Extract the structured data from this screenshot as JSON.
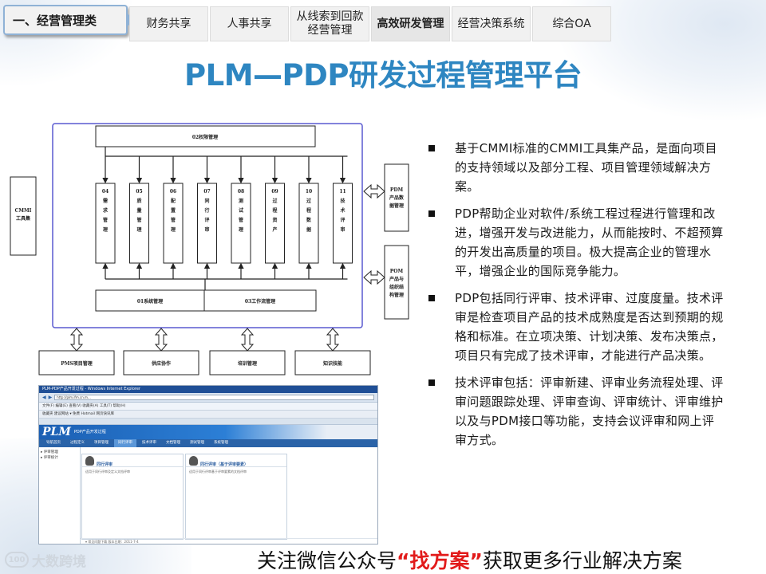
{
  "nav": {
    "category": "一、经营管理类",
    "tabs": [
      {
        "label": "财务共享",
        "active": false
      },
      {
        "label": "人事共享",
        "active": false
      },
      {
        "label": "从线索到回款\n经营管理",
        "active": false
      },
      {
        "label": "高效研发管理",
        "active": true
      },
      {
        "label": "经营决策系统",
        "active": false
      },
      {
        "label": "综合OA",
        "active": false
      }
    ]
  },
  "title": "PLM—PDP研发过程管理平台",
  "diagram": {
    "top_box": "02权限管理",
    "modules": [
      [
        "04",
        "需",
        "求",
        "管",
        "理"
      ],
      [
        "05",
        "质",
        "量",
        "管",
        "理"
      ],
      [
        "06",
        "配",
        "置",
        "管",
        "理"
      ],
      [
        "07",
        "同",
        "行",
        "评",
        "审"
      ],
      [
        "08",
        "测",
        "试",
        "管",
        "理"
      ],
      [
        "09",
        "过",
        "程",
        "资",
        "产"
      ],
      [
        "10",
        "过",
        "程",
        "数",
        "据"
      ],
      [
        "11",
        "技",
        "术",
        "评",
        "审"
      ]
    ],
    "bottom_left": "01系统管理",
    "bottom_right": "03工作流管理",
    "cmmi_box": [
      "CMMI",
      "工具集"
    ],
    "pdm_box": [
      "PDM",
      "产品数",
      "据管理"
    ],
    "pom_box": [
      "POM",
      "产品与",
      "组织结",
      "构管理"
    ],
    "bottom_boxes": [
      "PMS项目管理",
      "供应协作",
      "培训管理",
      "知识技能"
    ]
  },
  "screenshot": {
    "window_title": "PLM-PDP产品开发过程 - Windows Internet Explorer",
    "url": "http://plm.ifm.cn.m...",
    "menu": "文件(F)  编辑(E)  查看(V)  收藏夹(A)  工具(T)  帮助(H)",
    "favorites": "收藏夹   建议网站 ▾   免费 Hotmail   网页快讯库",
    "logo": "PLM",
    "logo_sub": "PDP产品开发过程",
    "nav_items": [
      {
        "label": "导航首页",
        "active": false
      },
      {
        "label": "过程定义",
        "active": false
      },
      {
        "label": "项目管理",
        "active": false
      },
      {
        "label": "同行评审",
        "active": true
      },
      {
        "label": "技术评审",
        "active": false
      },
      {
        "label": "文档管理",
        "active": false
      },
      {
        "label": "测试管理",
        "active": false
      },
      {
        "label": "系统管理",
        "active": false
      }
    ],
    "side_items": [
      "▸ 评审管理",
      "▸ 评审统计"
    ],
    "panel_left_title": "同行评审",
    "panel_left_body": "适用于同行评审及定义文档评审",
    "panel_right_title": "同行评审（基于评审要素）",
    "panel_right_body": "适用于同行评审基于评审要素的文档评审",
    "footer": "▾ 常见问题下载    版本日期：2011-7-4"
  },
  "bullets": [
    "基于CMMI标准的CMMI工具集产品，是面向项目的支持领域以及部分工程、项目管理领域解决方案。",
    "PDP帮助企业对软件/系统工程过程进行管理和改进，增强开发与改进能力，从而能按时、不超预算的开发出高质量的项目。极大提高企业的管理水平，增强企业的国际竞争能力。",
    "PDP包括同行评审、技术评审、过度度量。技术评审是检查项目产品的技术成熟度是否达到预期的规格和标准。在立项决策、计划决策、发布决策点，项目只有完成了技术评审，才能进行产品决策。",
    "技术评审包括：评审新建、评审业务流程处理、评审问题跟踪处理、评审查询、评审统计、评审维护以及与PDM接口等功能，支持会议评审和网上评审方式。"
  ],
  "footer": {
    "brand_logo": "100",
    "brand_name": "大数跨境",
    "text_before": "关注微信公众号",
    "highlight": "“找方案”",
    "text_after": "获取更多行业解决方案"
  },
  "colors": {
    "title": "#2e86c1",
    "highlight": "#e21b1b",
    "diagram_border": "#5a5ad0"
  }
}
